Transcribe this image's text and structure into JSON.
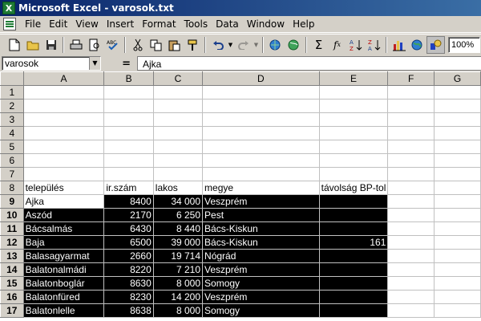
{
  "window": {
    "title": "Microsoft Excel - varosok.txt",
    "app_icon": "X"
  },
  "menu": [
    "File",
    "Edit",
    "View",
    "Insert",
    "Format",
    "Tools",
    "Data",
    "Window",
    "Help"
  ],
  "toolbar": {
    "zoom": "100%"
  },
  "formula_bar": {
    "name_box": "varosok",
    "equals": "=",
    "content": "Ajka"
  },
  "columns": [
    "A",
    "B",
    "C",
    "D",
    "E",
    "F",
    "G"
  ],
  "rows": [
    {
      "n": "1",
      "cells": [
        "",
        "",
        "",
        "",
        "",
        "",
        ""
      ]
    },
    {
      "n": "2",
      "cells": [
        "",
        "",
        "",
        "",
        "",
        "",
        ""
      ]
    },
    {
      "n": "3",
      "cells": [
        "",
        "",
        "",
        "",
        "",
        "",
        ""
      ]
    },
    {
      "n": "4",
      "cells": [
        "",
        "",
        "",
        "",
        "",
        "",
        ""
      ]
    },
    {
      "n": "5",
      "cells": [
        "",
        "",
        "",
        "",
        "",
        "",
        ""
      ]
    },
    {
      "n": "6",
      "cells": [
        "",
        "",
        "",
        "",
        "",
        "",
        ""
      ]
    },
    {
      "n": "7",
      "cells": [
        "",
        "",
        "",
        "",
        "",
        "",
        ""
      ]
    },
    {
      "n": "8",
      "cells": [
        "település",
        "ir.szám",
        "lakos",
        "megye",
        "távolság BP-tol",
        "",
        ""
      ]
    },
    {
      "n": "9",
      "cells": [
        "Ajka",
        "8400",
        "34 000",
        "Veszprém",
        "",
        "",
        ""
      ]
    },
    {
      "n": "10",
      "cells": [
        "Aszód",
        "2170",
        "6 250",
        "Pest",
        "",
        "",
        ""
      ]
    },
    {
      "n": "11",
      "cells": [
        "Bácsalmás",
        "6430",
        "8 440",
        "Bács-Kiskun",
        "",
        "",
        ""
      ]
    },
    {
      "n": "12",
      "cells": [
        "Baja",
        "6500",
        "39 000",
        "Bács-Kiskun",
        "161",
        "",
        ""
      ]
    },
    {
      "n": "13",
      "cells": [
        "Balasagyarmat",
        "2660",
        "19 714",
        "Nógrád",
        "",
        "",
        ""
      ]
    },
    {
      "n": "14",
      "cells": [
        "Balatonalmádi",
        "8220",
        "7 210",
        "Veszprém",
        "",
        "",
        ""
      ]
    },
    {
      "n": "15",
      "cells": [
        "Balatonboglár",
        "8630",
        "8 000",
        "Somogy",
        "",
        "",
        ""
      ]
    },
    {
      "n": "16",
      "cells": [
        "Balatonfüred",
        "8230",
        "14 200",
        "Veszprém",
        "",
        "",
        ""
      ]
    },
    {
      "n": "17",
      "cells": [
        "Balatonlelle",
        "8638",
        "8 000",
        "Somogy",
        "",
        "",
        ""
      ]
    }
  ]
}
